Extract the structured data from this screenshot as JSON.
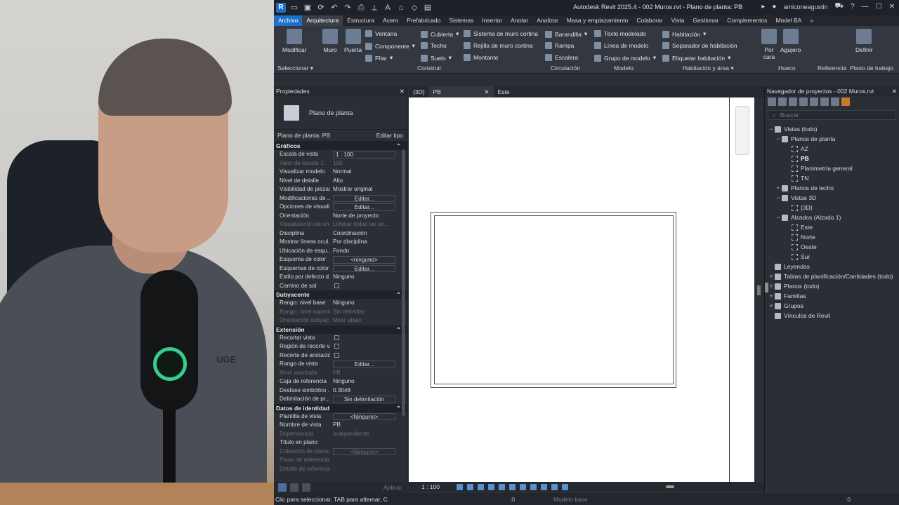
{
  "app": {
    "title": "Autodesk Revit 2025.4 - 002 Muros.rvt - Plano de planta: PB",
    "user": "amiconeagustin",
    "logo_letter": "R"
  },
  "menu": [
    "Archivo",
    "Arquitectura",
    "Estructura",
    "Acero",
    "Prefabricado",
    "Sistemas",
    "Insertar",
    "Anotar",
    "Analizar",
    "Masa y emplazamiento",
    "Colaborar",
    "Vista",
    "Gestionar",
    "Complementos",
    "Model BA"
  ],
  "ribbon": {
    "modificar": "Modificar",
    "seleccionar": "Seleccionar",
    "muro": "Muro",
    "puerta": "Puerta",
    "ventana": "Ventana",
    "componente": "Componente",
    "pilar": "Pilar",
    "cubierta": "Cubierta",
    "techo": "Techo",
    "suelo": "Suelo",
    "sistema_muro_cortina": "Sistema de muro cortina",
    "rejilla_muro_cortina": "Rejilla de muro cortina",
    "montante": "Montante",
    "construir": "Construir",
    "barandilla": "Barandilla",
    "rampa": "Rampa",
    "escalera": "Escalera",
    "circulacion": "Circulación",
    "texto_modelado": "Texto modelado",
    "linea_modelo": "Línea de modelo",
    "grupo_modelo": "Grupo de modelo",
    "modelo": "Modelo",
    "habitacion": "Habitación",
    "separador_habitacion": "Separador de habitación",
    "etiquetar_habitacion": "Etiquetar habitación",
    "habitacion_area": "Habitación y área",
    "por_cara": "Por cara",
    "agujero": "Agujero",
    "hueco": "Hueco",
    "referencia": "Referencia",
    "definir": "Definir",
    "plano_trabajo": "Plano de trabajo"
  },
  "properties": {
    "header": "Propiedades",
    "type_name": "Plano de planta",
    "filter_label": "Plano de planta: PB",
    "edit_type": "Editar tipo",
    "sections": {
      "graficos": "Gráficos",
      "subyacente": "Subyacente",
      "extension": "Extensión",
      "datos_identidad": "Datos de identidad"
    },
    "graficos_rows": [
      {
        "name": "Escala de vista",
        "value": "1 : 100"
      },
      {
        "name": "Valor de escala    1:",
        "value": "100"
      },
      {
        "name": "Visualizar modelo",
        "value": "Normal"
      },
      {
        "name": "Nivel de detalle",
        "value": "Alto"
      },
      {
        "name": "Visibilidad de piezas",
        "value": "Mostrar original"
      },
      {
        "name": "Modificaciones de ...",
        "value": "Editar..."
      },
      {
        "name": "Opciones de visuali...",
        "value": "Editar..."
      },
      {
        "name": "Orientación",
        "value": "Norte de proyecto"
      },
      {
        "name": "Visualización de un...",
        "value": "Limpiar todas las un..."
      },
      {
        "name": "Disciplina",
        "value": "Coordinación"
      },
      {
        "name": "Mostrar líneas ocul...",
        "value": "Por disciplina"
      },
      {
        "name": "Ubicación de esqu...",
        "value": "Fondo"
      },
      {
        "name": "Esquema de color",
        "value": "<ninguno>"
      },
      {
        "name": "Esquemas de color ...",
        "value": "Editar..."
      },
      {
        "name": "Estilo por defecto d...",
        "value": "Ninguno"
      },
      {
        "name": "Camino de sol",
        "value": ""
      }
    ],
    "subyacente_rows": [
      {
        "name": "Rango: nivel base",
        "value": "Ninguno"
      },
      {
        "name": "Rango: nivel superior",
        "value": "Sin delimitar"
      },
      {
        "name": "Orientación subyac...",
        "value": "Mirar abajo"
      }
    ],
    "extension_rows": [
      {
        "name": "Recortar vista",
        "value": ""
      },
      {
        "name": "Región de recorte v...",
        "value": ""
      },
      {
        "name": "Recorte de anotación",
        "value": ""
      },
      {
        "name": "Rango de vista",
        "value": "Editar..."
      },
      {
        "name": "Nivel asociado",
        "value": "PB"
      },
      {
        "name": "Caja de referencia",
        "value": "Ninguno"
      },
      {
        "name": "Desfase simbólico ...",
        "value": "0.3048"
      },
      {
        "name": "Delimitación de pr...",
        "value": "Sin delimitación"
      }
    ],
    "identidad_rows": [
      {
        "name": "Plantilla de vista",
        "value": "<Ninguno>"
      },
      {
        "name": "Nombre de vista",
        "value": "PB"
      },
      {
        "name": "Dependencia",
        "value": "Independiente"
      },
      {
        "name": "Título en plano",
        "value": ""
      },
      {
        "name": "Colección de plano...",
        "value": "<Ninguno>"
      },
      {
        "name": "Plano de referencia",
        "value": ""
      },
      {
        "name": "Detalle de referencia",
        "value": ""
      }
    ],
    "apply": "Aplicar"
  },
  "view_tabs": [
    "{3D}",
    "PB",
    "Este"
  ],
  "viewbar": {
    "scale": "1 : 100"
  },
  "browser": {
    "header": "Navegador de proyectos - 002 Muros.rvt",
    "search_placeholder": "Buscar",
    "tree": [
      {
        "label": "Vistas (todo)",
        "toggle": "−"
      },
      {
        "label": "Planos de planta",
        "toggle": "−"
      },
      {
        "label": "AZ",
        "toggle": ""
      },
      {
        "label": "PB",
        "toggle": ""
      },
      {
        "label": "Planimetría general",
        "toggle": ""
      },
      {
        "label": "TN",
        "toggle": ""
      },
      {
        "label": "Planos de techo",
        "toggle": "+"
      },
      {
        "label": "Vistas 3D",
        "toggle": "−"
      },
      {
        "label": "{3D}",
        "toggle": ""
      },
      {
        "label": "Alzados (Alzado 1)",
        "toggle": "−"
      },
      {
        "label": "Este",
        "toggle": ""
      },
      {
        "label": "Norte",
        "toggle": ""
      },
      {
        "label": "Oeste",
        "toggle": ""
      },
      {
        "label": "Sur",
        "toggle": ""
      },
      {
        "label": "Leyendas",
        "toggle": ""
      },
      {
        "label": "Tablas de planificación/Cantidades (todo)",
        "toggle": "+"
      },
      {
        "label": "Planos (todo)",
        "toggle": "+"
      },
      {
        "label": "Familias",
        "toggle": "+"
      },
      {
        "label": "Grupos",
        "toggle": "+"
      },
      {
        "label": "Vínculos de Revit",
        "toggle": ""
      }
    ]
  },
  "status": {
    "text": "Clic para seleccionar, TAB para alternar, C",
    "zero_left": ":0",
    "model": "Modelo base",
    "zero_right": ":0"
  },
  "webcam": {
    "logo_text": "UGE"
  }
}
